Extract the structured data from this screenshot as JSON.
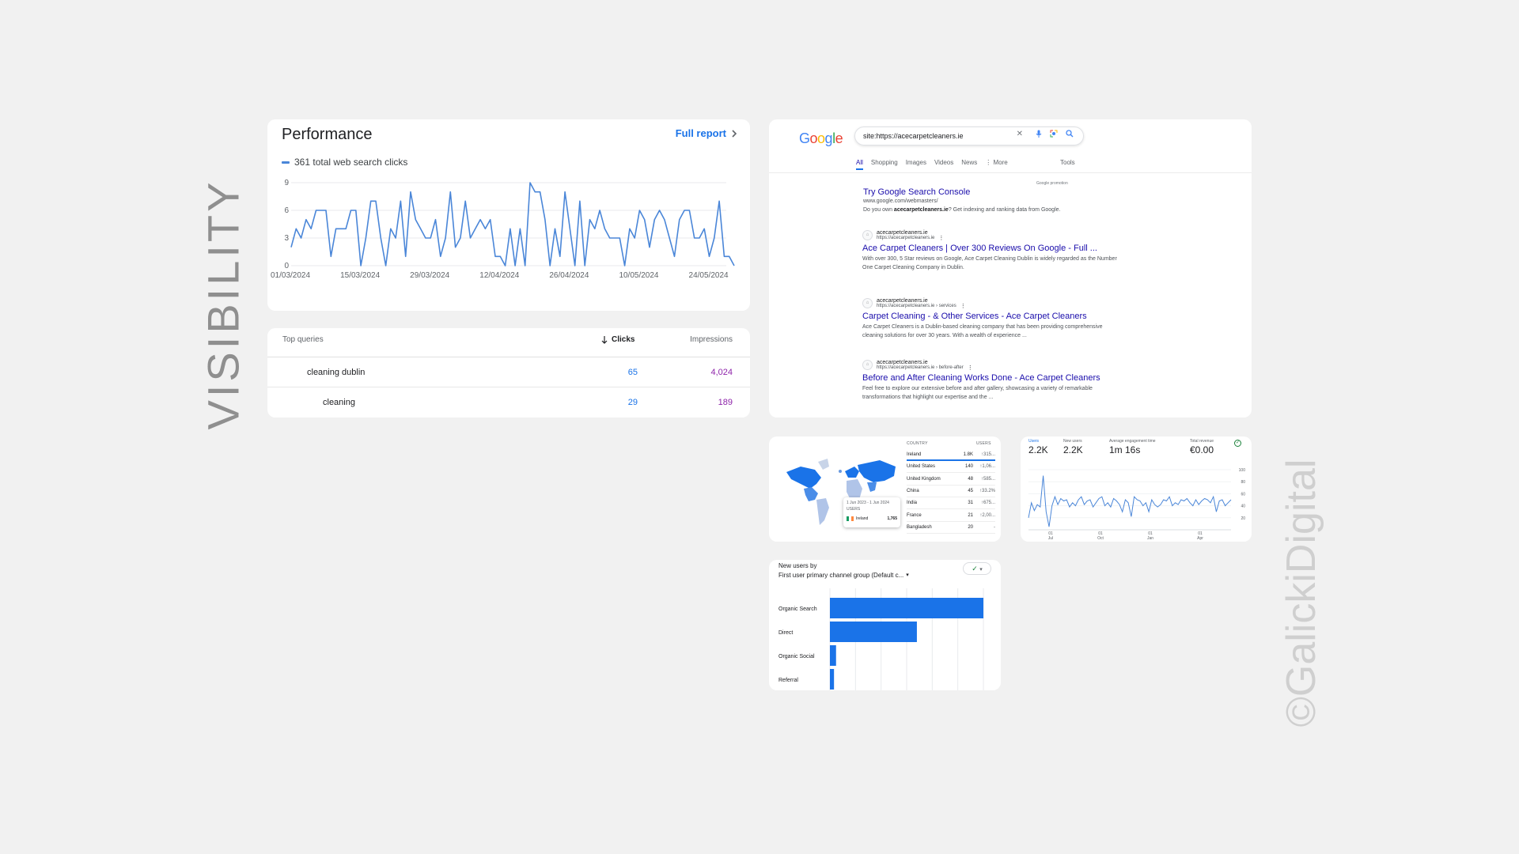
{
  "side_title": "VISIBILITY",
  "watermark": "©GalickiDigital",
  "performance": {
    "title": "Performance",
    "full_report": "Full report",
    "legend": "361 total web search clicks",
    "chart_data": {
      "type": "line",
      "series": [
        {
          "name": "361 total web search clicks",
          "color": "#4a86d8",
          "values": [
            2,
            4,
            3,
            5,
            4,
            6,
            6,
            6,
            1,
            4,
            4,
            4,
            6,
            6,
            0,
            3,
            7,
            7,
            3,
            0,
            4,
            3,
            7,
            1,
            8,
            5,
            4,
            3,
            3,
            5,
            1,
            3,
            8,
            2,
            3,
            7,
            3,
            4,
            5,
            4,
            5,
            1,
            1,
            0,
            4,
            0,
            4,
            0,
            9,
            8,
            8,
            5,
            0,
            4,
            1,
            8,
            4,
            0,
            7,
            0,
            5,
            4,
            6,
            4,
            3,
            3,
            3,
            0,
            4,
            3,
            6,
            5,
            2,
            5,
            6,
            5,
            3,
            1,
            5,
            6,
            6,
            3,
            3,
            4,
            1,
            3,
            7,
            1,
            1,
            0
          ]
        }
      ],
      "x_start": "01/03/2024",
      "x_tick_labels": [
        "01/03/2024",
        "15/03/2024",
        "29/03/2024",
        "12/04/2024",
        "26/04/2024",
        "10/05/2024",
        "24/05/2024"
      ],
      "y_ticks": [
        "0",
        "3",
        "6",
        "9"
      ],
      "ylim": [
        0,
        9
      ],
      "grid": true
    }
  },
  "queries": {
    "header_query": "Top queries",
    "header_clicks": "Clicks",
    "header_impressions": "Impressions",
    "rows": [
      {
        "query": "cleaning dublin",
        "clicks": "65",
        "impressions": "4,024"
      },
      {
        "query": "cleaning",
        "clicks": "29",
        "impressions": "189"
      }
    ]
  },
  "google": {
    "logo": "Google",
    "query": "site:https://acecarpetcleaners.ie",
    "tabs": [
      "All",
      "Shopping",
      "Images",
      "Videos",
      "News",
      "More"
    ],
    "tools": "Tools",
    "promo_label": "Google promotion",
    "promo": {
      "title": "Try Google Search Console",
      "url": "www.google.com/webmasters/",
      "snippet_pre": "Do you own ",
      "snippet_bold": "acecarpetcleaners.ie",
      "snippet_post": "? Get indexing and ranking data from Google."
    },
    "results": [
      {
        "site": "acecarpetcleaners.ie",
        "url": "https://acecarpetcleaners.ie",
        "title": "Ace Carpet Cleaners | Over 300 Reviews On Google - Full ...",
        "snippet": "With over 300, 5 Star reviews on Google, Ace Carpet Cleaning Dublin is widely regarded as the Number One Carpet Cleaning Company in Dublin."
      },
      {
        "site": "acecarpetcleaners.ie",
        "url": "https://acecarpetcleaners.ie › services",
        "title": "Carpet Cleaning - & Other Services - Ace Carpet Cleaners",
        "snippet": "Ace Carpet Cleaners is a Dublin-based cleaning company that has been providing comprehensive cleaning solutions for over 30 years. With a wealth of experience ..."
      },
      {
        "site": "acecarpetcleaners.ie",
        "url": "https://acecarpetcleaners.ie › before-after",
        "title": "Before and After Cleaning Works Done - Ace Carpet Cleaners",
        "snippet": "Feel free to explore our extensive before and after gallery, showcasing a variety of remarkable transformations that highlight our expertise and the ..."
      }
    ]
  },
  "countries": {
    "header_country": "COUNTRY",
    "header_users": "USERS",
    "rows": [
      {
        "name": "Ireland",
        "users": "1.8K",
        "pct": "↑315..."
      },
      {
        "name": "United States",
        "users": "140",
        "pct": "↑1,06..."
      },
      {
        "name": "United Kingdom",
        "users": "48",
        "pct": "↑585..."
      },
      {
        "name": "China",
        "users": "45",
        "pct": "↑33.2%"
      },
      {
        "name": "India",
        "users": "31",
        "pct": "↑675..."
      },
      {
        "name": "France",
        "users": "21",
        "pct": "↑2,00..."
      },
      {
        "name": "Bangladesh",
        "users": "20",
        "pct": "-"
      }
    ],
    "tooltip": {
      "date": "1 Jun 2023 - 1 Jun 2024",
      "label": "USERS",
      "country": "Ireland",
      "value": "1,765"
    }
  },
  "users_metrics": {
    "metrics": [
      {
        "label": "Users",
        "value": "2.2K"
      },
      {
        "label": "New users",
        "value": "2.2K"
      },
      {
        "label": "Average engagement time",
        "value": "1m 16s"
      },
      {
        "label": "Total revenue",
        "value": "€0.00"
      }
    ],
    "chart_data": {
      "type": "line",
      "series": [
        {
          "name": "Users",
          "color": "#4a86d8",
          "values": [
            20,
            45,
            32,
            42,
            38,
            90,
            30,
            5,
            40,
            55,
            42,
            52,
            48,
            50,
            38,
            45,
            40,
            50,
            55,
            42,
            48,
            50,
            38,
            45,
            52,
            55,
            40,
            45,
            38,
            52,
            48,
            42,
            30,
            50,
            45,
            22,
            55,
            50,
            48,
            40,
            45,
            30,
            50,
            42,
            38,
            42,
            50,
            48,
            55,
            40,
            45,
            42,
            50,
            48,
            52,
            45,
            40,
            50,
            42,
            48,
            52,
            50,
            45,
            55,
            30,
            48,
            50,
            40,
            45,
            50
          ]
        }
      ],
      "x_tick_labels": [
        "01 Jul",
        "01 Oct",
        "01 Jan",
        "01 Apr"
      ],
      "y_ticks": [
        "20",
        "40",
        "60",
        "80",
        "100"
      ],
      "ylim": [
        0,
        100
      ]
    }
  },
  "channels": {
    "title": "New users by",
    "subtitle": "First user primary channel group (Default c...",
    "chart_data": {
      "type": "bar",
      "categories": [
        "Organic Search",
        "Direct",
        "Organic Social",
        "Referral"
      ],
      "values": [
        1500,
        850,
        60,
        40
      ],
      "xlim": [
        0,
        1500
      ],
      "color": "#1a73e8"
    }
  }
}
